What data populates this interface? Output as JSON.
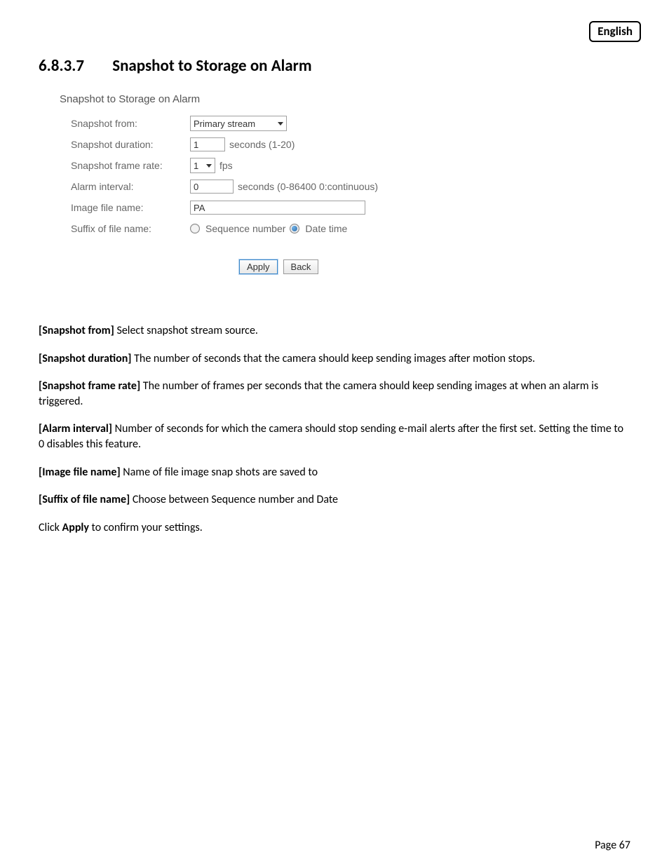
{
  "lang_badge": "English",
  "heading": {
    "number": "6.8.3.7",
    "title": "Snapshot to Storage on Alarm"
  },
  "ui": {
    "panel_title": "Snapshot to Storage on Alarm",
    "rows": {
      "from": {
        "label": "Snapshot from:",
        "value": "Primary stream"
      },
      "duration": {
        "label": "Snapshot duration:",
        "value": "1",
        "hint": "seconds (1-20)"
      },
      "fps": {
        "label": "Snapshot frame rate:",
        "value": "1",
        "hint": "fps"
      },
      "interval": {
        "label": "Alarm interval:",
        "value": "0",
        "hint": "seconds (0-86400 0:continuous)"
      },
      "name": {
        "label": "Image file name:",
        "value": "PA"
      },
      "suffix": {
        "label": "Suffix of file name:",
        "opt1": "Sequence number",
        "opt2": "Date time",
        "selected": "opt2"
      }
    },
    "buttons": {
      "apply": "Apply",
      "back": "Back"
    }
  },
  "desc": {
    "p1": {
      "b": "[Snapshot from]",
      "t": " Select snapshot stream source."
    },
    "p2": {
      "b": "[Snapshot duration]",
      "t": " The number of seconds that the camera should keep sending images after motion stops."
    },
    "p3": {
      "b": "[Snapshot frame rate]",
      "t": " The number of frames per seconds that the camera should keep sending images at when an alarm is triggered."
    },
    "p4": {
      "b": "[Alarm interval]",
      "t": " Number of seconds for which the camera should stop sending e-mail alerts after the first set. Setting the time to 0 disables this feature."
    },
    "p5": {
      "b": "[Image file name]",
      "t": " Name of file image snap shots are saved to"
    },
    "p6": {
      "b": "[Suffix of file name]",
      "t": " Choose between Sequence number and Date"
    },
    "p7": {
      "pre": "Click ",
      "b": "Apply",
      "post": " to confirm your settings."
    }
  },
  "footer": {
    "label": "Page ",
    "num": "67"
  }
}
